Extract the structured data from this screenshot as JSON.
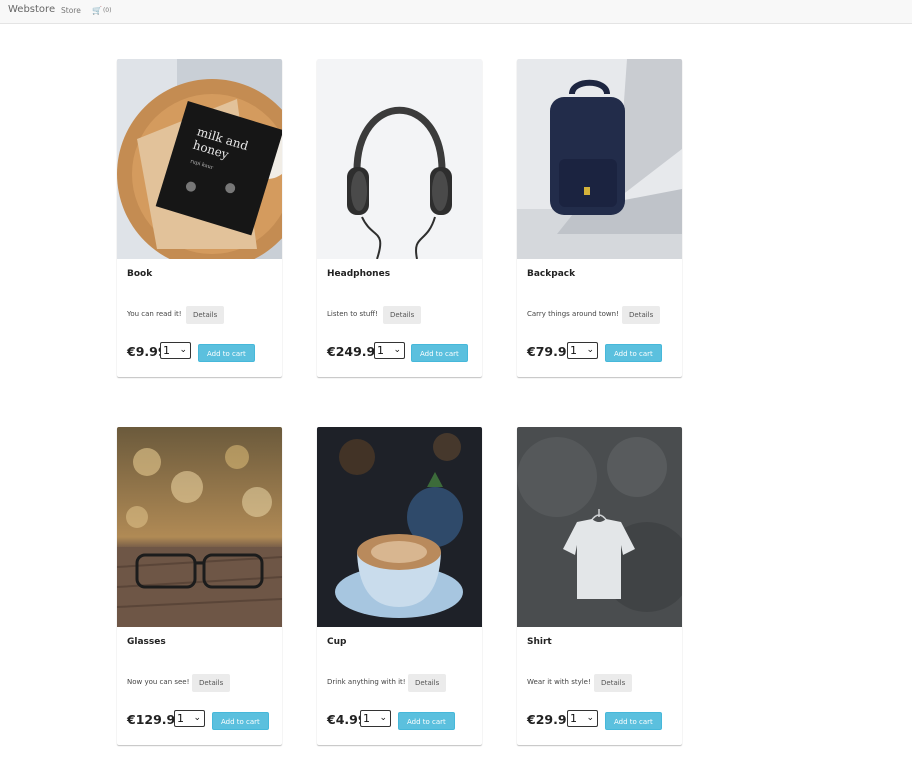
{
  "navbar": {
    "brand": "Webstore",
    "store_link": "Store",
    "cart_count": "(0)",
    "cart_icon": "shopping-cart-icon"
  },
  "products": [
    {
      "title": "Book",
      "description": "You can read it!",
      "details_label": "Details",
      "price": "€9.99",
      "quantity": "1",
      "add_label": "Add to cart",
      "image": "book"
    },
    {
      "title": "Headphones",
      "description": "Listen to stuff!",
      "details_label": "Details",
      "price": "€249.99",
      "quantity": "1",
      "add_label": "Add to cart",
      "image": "headphones"
    },
    {
      "title": "Backpack",
      "description": "Carry things around town!",
      "details_label": "Details",
      "price": "€79.99",
      "quantity": "1",
      "add_label": "Add to cart",
      "image": "backpack"
    },
    {
      "title": "Glasses",
      "description": "Now you can see!",
      "details_label": "Details",
      "price": "€129.99",
      "quantity": "1",
      "add_label": "Add to cart",
      "image": "glasses"
    },
    {
      "title": "Cup",
      "description": "Drink anything with it!",
      "details_label": "Details",
      "price": "€4.99",
      "quantity": "1",
      "add_label": "Add to cart",
      "image": "cup"
    },
    {
      "title": "Shirt",
      "description": "Wear it with style!",
      "details_label": "Details",
      "price": "€29.99",
      "quantity": "1",
      "add_label": "Add to cart",
      "image": "shirt"
    }
  ],
  "book_cover": {
    "line1": "milk and",
    "line2": "honey",
    "author": "rupi kaur"
  },
  "colors": {
    "accent": "#5bc0de",
    "navbar_bg": "#f8f8f8"
  }
}
